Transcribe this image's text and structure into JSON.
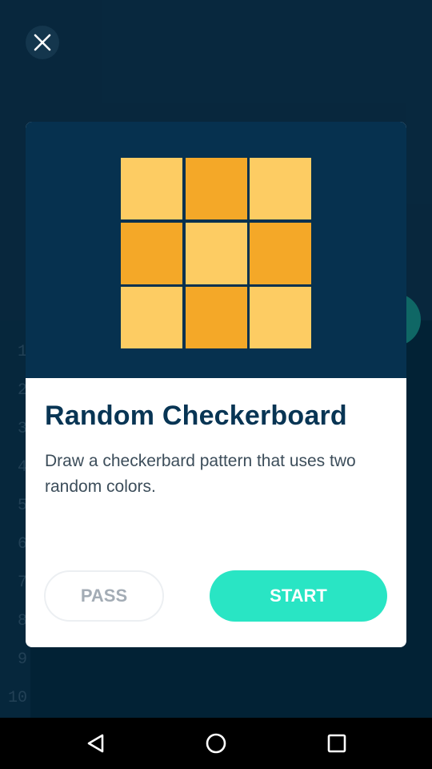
{
  "background": {
    "line_numbers": [
      "1",
      "2",
      "3",
      "4",
      "5",
      "6",
      "7",
      "8",
      "9",
      "10"
    ]
  },
  "close_icon": "close-icon",
  "modal": {
    "title": "Random Checkerboard",
    "description": "Draw a checkerbard pattern that uses two random colors.",
    "illustration": {
      "light_color": "#fdcc63",
      "dark_color": "#f4a828",
      "pattern": [
        "light",
        "dark",
        "light",
        "dark",
        "light",
        "dark",
        "light",
        "dark",
        "light"
      ]
    },
    "pass_label": "PASS",
    "start_label": "START"
  },
  "navbar": {
    "back_icon": "back-triangle-icon",
    "home_icon": "home-circle-icon",
    "recents_icon": "recents-square-icon"
  },
  "colors": {
    "hero_bg": "#06314f",
    "title": "#083554",
    "accent": "#29e5c4"
  }
}
